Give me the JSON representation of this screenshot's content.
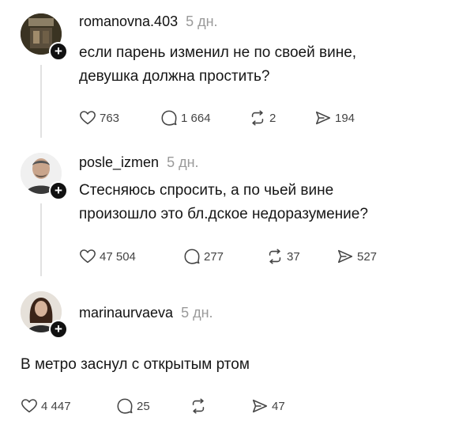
{
  "posts": [
    {
      "username": "romanovna.403",
      "time": "5 дн.",
      "text_lines": [
        "если парень изменил не по своей вине,",
        "девушка должна простить?"
      ],
      "likes": "763",
      "replies": "1 664",
      "reposts": "2",
      "shares": "194"
    },
    {
      "username": "posle_izmen",
      "time": "5 дн.",
      "text_lines": [
        "Стесняюсь спросить, а по чьей вине",
        "произошло это бл.дское недоразумение?"
      ],
      "likes": "47 504",
      "replies": "277",
      "reposts": "37",
      "shares": "527"
    },
    {
      "username": "marinaurvaeva",
      "time": "5 дн.",
      "text_lines": [
        "В метро заснул с открытым ртом"
      ],
      "likes": "4 447",
      "replies": "25",
      "reposts": "",
      "shares": "47"
    }
  ],
  "icons": {
    "like": "heart-icon",
    "reply": "comment-icon",
    "repost": "repost-icon",
    "share": "send-icon",
    "follow": "plus-icon"
  }
}
